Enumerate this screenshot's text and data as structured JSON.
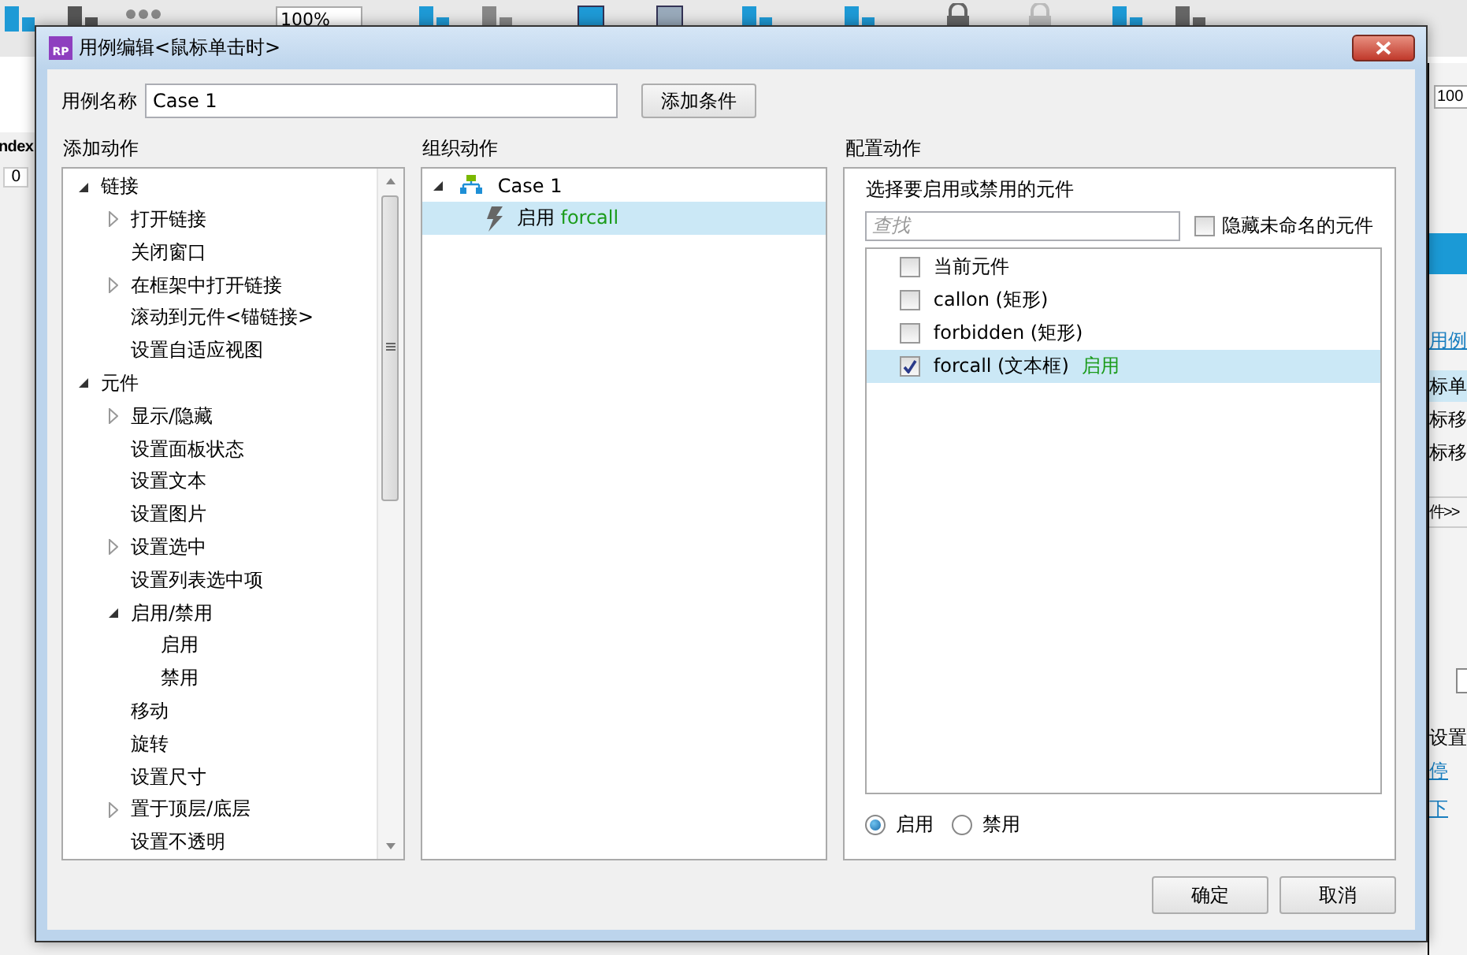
{
  "app": {
    "zoom": "100%",
    "ruler_label": "ndex",
    "ruler_tick": "0",
    "right_zoom": "100",
    "right_link": "用例",
    "right_events": [
      {
        "label": "标单",
        "selected": true
      },
      {
        "label": "标移",
        "selected": false
      },
      {
        "label": "标移",
        "selected": false
      }
    ],
    "right_more": "件>>",
    "right_checkbox": {
      "checked": false
    },
    "right_setting": "设置",
    "right_links": [
      "停",
      "下"
    ]
  },
  "dialog": {
    "app_icon_text": "RP",
    "title": "用例编辑<鼠标单击时>",
    "case_name_label": "用例名称",
    "case_name": "Case 1",
    "add_condition_button": "添加条件",
    "add_actions": {
      "heading": "添加动作",
      "tree": [
        {
          "label": "链接",
          "kind": "folder",
          "expanded": true,
          "children": [
            {
              "label": "打开链接",
              "kind": "folder",
              "expanded": false
            },
            {
              "label": "关闭窗口",
              "kind": "action"
            },
            {
              "label": "在框架中打开链接",
              "kind": "folder",
              "expanded": false
            },
            {
              "label": "滚动到元件<锚链接>",
              "kind": "action"
            },
            {
              "label": "设置自适应视图",
              "kind": "action"
            }
          ]
        },
        {
          "label": "元件",
          "kind": "folder",
          "expanded": true,
          "children": [
            {
              "label": "显示/隐藏",
              "kind": "folder",
              "expanded": false
            },
            {
              "label": "设置面板状态",
              "kind": "action"
            },
            {
              "label": "设置文本",
              "kind": "action"
            },
            {
              "label": "设置图片",
              "kind": "action"
            },
            {
              "label": "设置选中",
              "kind": "folder",
              "expanded": false
            },
            {
              "label": "设置列表选中项",
              "kind": "action"
            },
            {
              "label": "启用/禁用",
              "kind": "folder",
              "expanded": true,
              "children": [
                {
                  "label": "启用",
                  "kind": "action"
                },
                {
                  "label": "禁用",
                  "kind": "action"
                }
              ]
            },
            {
              "label": "移动",
              "kind": "action"
            },
            {
              "label": "旋转",
              "kind": "action"
            },
            {
              "label": "设置尺寸",
              "kind": "action"
            },
            {
              "label": "置于顶层/底层",
              "kind": "folder",
              "expanded": false
            },
            {
              "label": "设置不透明",
              "kind": "action"
            }
          ]
        }
      ]
    },
    "organize": {
      "heading": "组织动作",
      "cases": [
        {
          "label": "Case 1",
          "expanded": true,
          "selected": false,
          "actions": [
            {
              "label": "启用",
              "target": "forcall",
              "selected": true
            }
          ]
        }
      ]
    },
    "configure": {
      "heading": "配置动作",
      "prompt": "选择要启用或禁用的元件",
      "search": {
        "placeholder": "查找"
      },
      "hide_unnamed": {
        "label": "隐藏未命名的元件",
        "checked": false
      },
      "widgets": [
        {
          "label": "当前元件",
          "checked": false,
          "selected": false
        },
        {
          "label": "callon (矩形)",
          "checked": false,
          "selected": false
        },
        {
          "label": "forbidden (矩形)",
          "checked": false,
          "selected": false
        },
        {
          "label": "forcall (文本框)",
          "status": "启用",
          "checked": true,
          "selected": true
        }
      ],
      "modes": [
        {
          "label": "启用",
          "selected": true
        },
        {
          "label": "禁用",
          "selected": false
        }
      ]
    },
    "buttons": [
      "确定",
      "取消"
    ]
  }
}
